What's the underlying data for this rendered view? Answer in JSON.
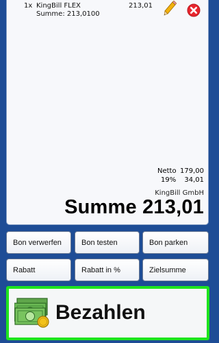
{
  "receipt": {
    "items": [
      {
        "qty": "1x",
        "name": "KingBill FLEX",
        "price": "213,01",
        "subtotal": "Summe: 213,0100"
      }
    ],
    "netto_label": "Netto",
    "netto_value": "179,00",
    "vat_label": "19%",
    "vat_value": "34,01",
    "company": "KingBill GmbH",
    "total": "Summe 213,01"
  },
  "buttons": {
    "bon_verwerfen": "Bon verwerfen",
    "bon_testen": "Bon testen",
    "bon_parken": "Bon parken",
    "rabatt": "Rabatt",
    "rabatt_prozent": "Rabatt in %",
    "zielsumme": "Zielsumme",
    "bezahlen": "Bezahlen"
  },
  "icons": {
    "edit": "pencil-icon",
    "delete": "delete-icon",
    "pay": "money-icon"
  },
  "colors": {
    "background": "#1e4d96",
    "pay_border": "#1ee51e",
    "delete": "#e8262e"
  }
}
